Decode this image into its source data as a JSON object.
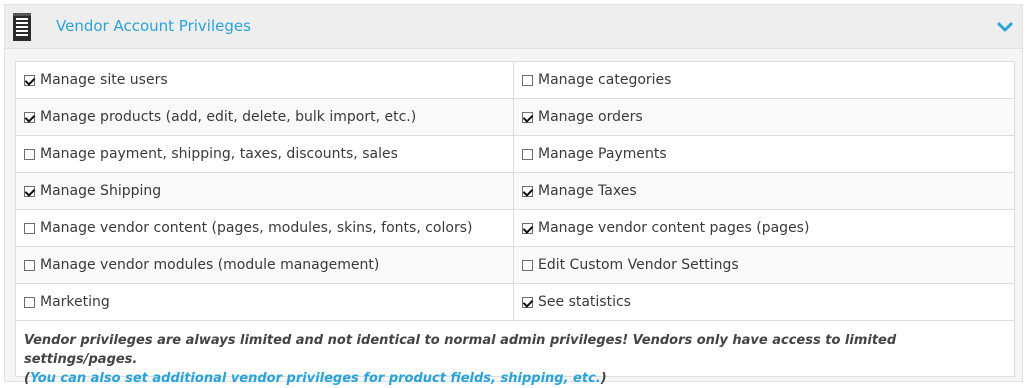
{
  "header": {
    "title": "Vendor Account Privileges",
    "icon": "document-icon",
    "collapse_icon": "chevron-down-icon",
    "accent": "#2aa3d6"
  },
  "privileges": [
    {
      "left": {
        "label": "Manage site users",
        "checked": true
      },
      "right": {
        "label": "Manage categories",
        "checked": false
      }
    },
    {
      "left": {
        "label": "Manage products (add, edit, delete, bulk import, etc.)",
        "checked": true
      },
      "right": {
        "label": "Manage orders",
        "checked": true
      }
    },
    {
      "left": {
        "label": "Manage payment, shipping, taxes, discounts, sales",
        "checked": false
      },
      "right": {
        "label": "Manage Payments",
        "checked": false
      }
    },
    {
      "left": {
        "label": "Manage Shipping",
        "checked": true
      },
      "right": {
        "label": "Manage Taxes",
        "checked": true
      }
    },
    {
      "left": {
        "label": "Manage vendor content (pages, modules, skins, fonts, colors)",
        "checked": false
      },
      "right": {
        "label": "Manage vendor content pages (pages)",
        "checked": true
      }
    },
    {
      "left": {
        "label": "Manage vendor modules (module management)",
        "checked": false
      },
      "right": {
        "label": "Edit Custom Vendor Settings",
        "checked": false
      }
    },
    {
      "left": {
        "label": "Marketing",
        "checked": false
      },
      "right": {
        "label": "See statistics",
        "checked": true
      }
    }
  ],
  "footer": {
    "note": "Vendor privileges are always limited and not identical to normal admin privileges! Vendors only have access to limited settings/pages.",
    "paren_open": "(",
    "link": "You can also set additional vendor privileges for product fields, shipping, etc.",
    "paren_close": ")"
  }
}
